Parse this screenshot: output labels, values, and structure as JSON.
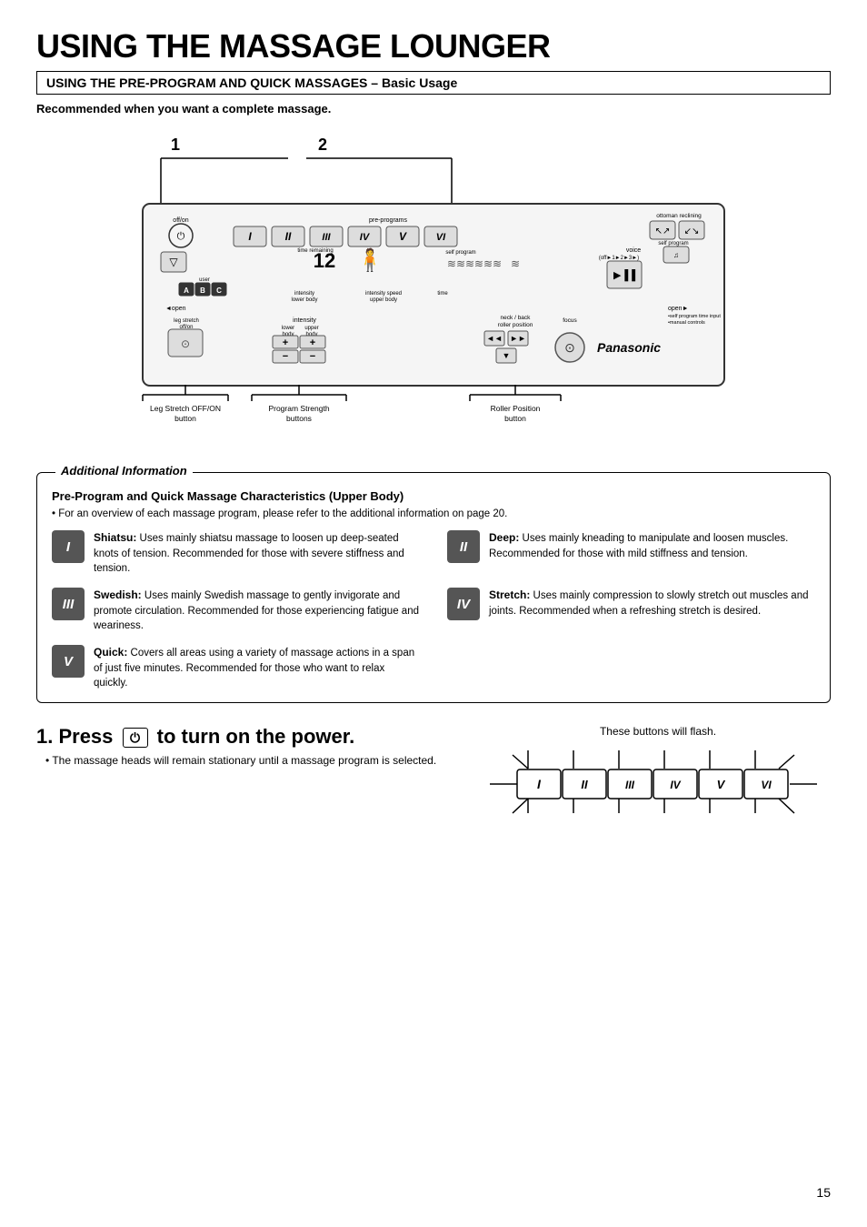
{
  "title": "USING THE MASSAGE LOUNGER",
  "section_header": "USING THE PRE-PROGRAM AND QUICK MASSAGES  – Basic Usage",
  "subtitle": "Recommended when you want a complete massage.",
  "callout_1": "1",
  "callout_2": "2",
  "diagram_labels": [
    {
      "label": "Leg Stretch OFF/ON\nbutton"
    },
    {
      "label": "Program Strength\nbuttons"
    },
    {
      "label": "Roller Position\nbutton"
    }
  ],
  "additional_title": "Additional Information",
  "additional_subtitle": "Pre-Program and Quick Massage Characteristics (Upper Body)",
  "additional_note": "• For an overview of each massage program, please refer to the additional information on page 20.",
  "massages": [
    {
      "icon": "I",
      "col": 0,
      "name": "Shiatsu:",
      "desc": "Uses mainly shiatsu massage to loosen up deep-seated knots of tension. Recommended for those with severe stiffness and tension."
    },
    {
      "icon": "II",
      "col": 1,
      "name": "Deep:",
      "desc": "Uses mainly kneading to manipulate and loosen muscles. Recommended for those with mild stiffness and tension."
    },
    {
      "icon": "III",
      "col": 0,
      "name": "Swedish:",
      "desc": "Uses mainly Swedish massage to gently invigorate and promote circulation. Recommended for those experiencing fatigue and weariness."
    },
    {
      "icon": "IV",
      "col": 1,
      "name": "Stretch:",
      "desc": "Uses mainly compression to slowly stretch out muscles and joints. Recommended when a refreshing stretch is desired."
    },
    {
      "icon": "V",
      "col": 0,
      "name": "Quick:",
      "desc": "Covers all areas using a variety of massage actions in a span of just five minutes. Recommended for those who want to relax quickly."
    }
  ],
  "step1_title": "1. Press",
  "step1_title2": "to turn on the power.",
  "step1_bullet": "The massage heads will remain stationary until a massage program is selected.",
  "flash_note": "These buttons will flash.",
  "flash_buttons": [
    "I",
    "II",
    "III",
    "IV",
    "V",
    "VI"
  ],
  "page_number": "15"
}
